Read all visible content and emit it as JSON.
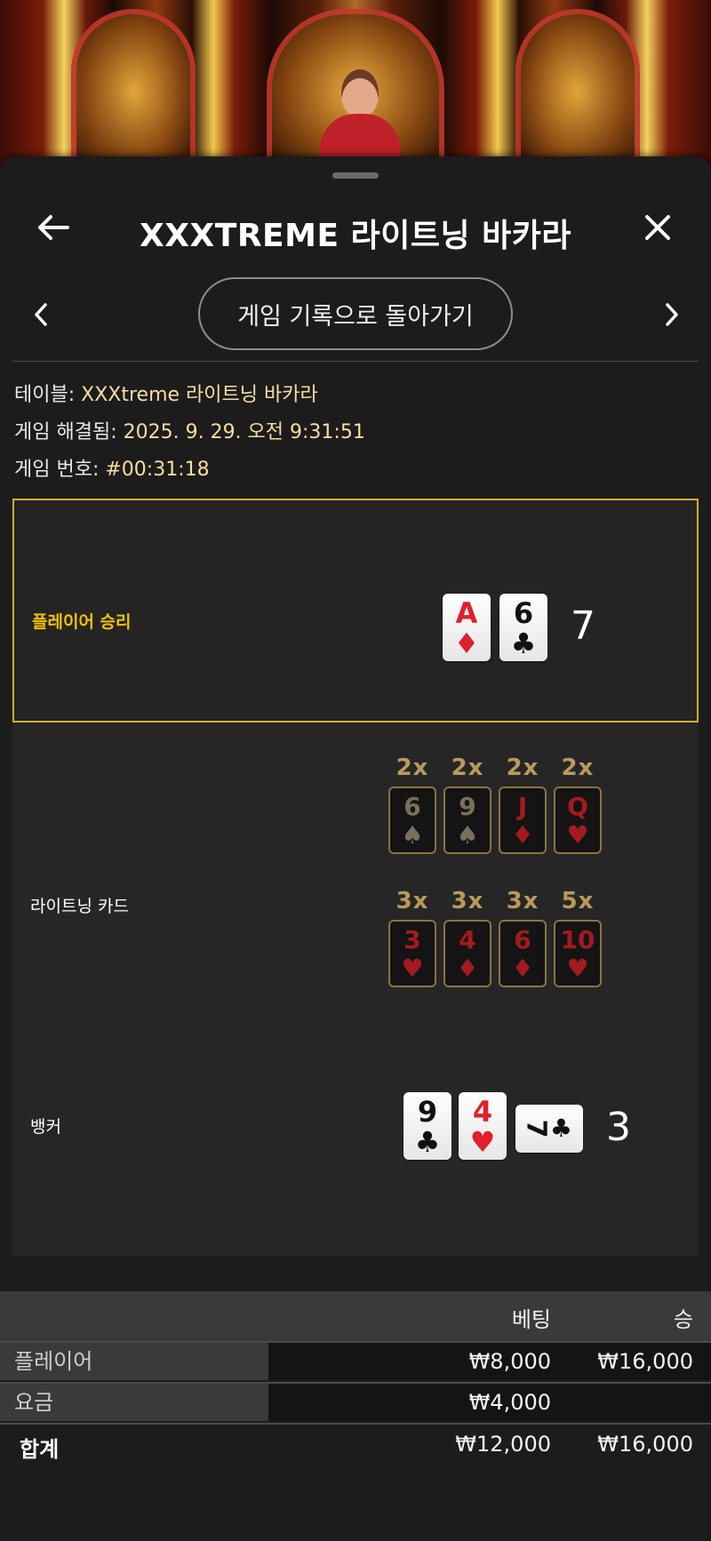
{
  "header": {
    "title": "XXXTREME 라이트닝 바카라"
  },
  "nav": {
    "back_to_history": "게임 기록으로 돌아가기"
  },
  "info": {
    "table_label": "테이블:",
    "table_value": "XXXtreme 라이트닝 바카라",
    "resolved_label": "게임 해결됨:",
    "resolved_value": "2025. 9. 29. 오전 9:31:51",
    "game_number_label": "게임 번호:",
    "game_number_value": "#00:31:18"
  },
  "player": {
    "label": "플레이어 승리",
    "cards": [
      {
        "rank": "A",
        "suit": "♦"
      },
      {
        "rank": "6",
        "suit": "♣"
      }
    ],
    "score": "7"
  },
  "lightning": {
    "label": "라이트닝 카드",
    "cards": [
      {
        "multiplier": "2x",
        "rank": "6",
        "suit": "♠"
      },
      {
        "multiplier": "2x",
        "rank": "9",
        "suit": "♠"
      },
      {
        "multiplier": "2x",
        "rank": "J",
        "suit": "♦"
      },
      {
        "multiplier": "2x",
        "rank": "Q",
        "suit": "♥"
      },
      {
        "multiplier": "3x",
        "rank": "3",
        "suit": "♥"
      },
      {
        "multiplier": "3x",
        "rank": "4",
        "suit": "♦"
      },
      {
        "multiplier": "3x",
        "rank": "6",
        "suit": "♦"
      },
      {
        "multiplier": "5x",
        "rank": "10",
        "suit": "♥"
      }
    ]
  },
  "banker": {
    "label": "뱅커",
    "cards": [
      {
        "rank": "9",
        "suit": "♣"
      },
      {
        "rank": "4",
        "suit": "♥"
      },
      {
        "rank": "7",
        "suit": "♣"
      }
    ],
    "score": "3"
  },
  "bets": {
    "columns": {
      "bet": "베팅",
      "win": "승"
    },
    "rows": [
      {
        "label": "플레이어",
        "bet": "₩8,000",
        "win": "₩16,000"
      },
      {
        "label": "요금",
        "bet": "₩4,000",
        "win": ""
      }
    ],
    "total": {
      "label": "합계",
      "bet": "₩12,000",
      "win": "₩16,000"
    }
  },
  "colors": {
    "accent_gold": "#d4af1f",
    "player_win_text": "#f2c200",
    "info_value": "#f5dfa0",
    "card_red": "#e0202a"
  }
}
